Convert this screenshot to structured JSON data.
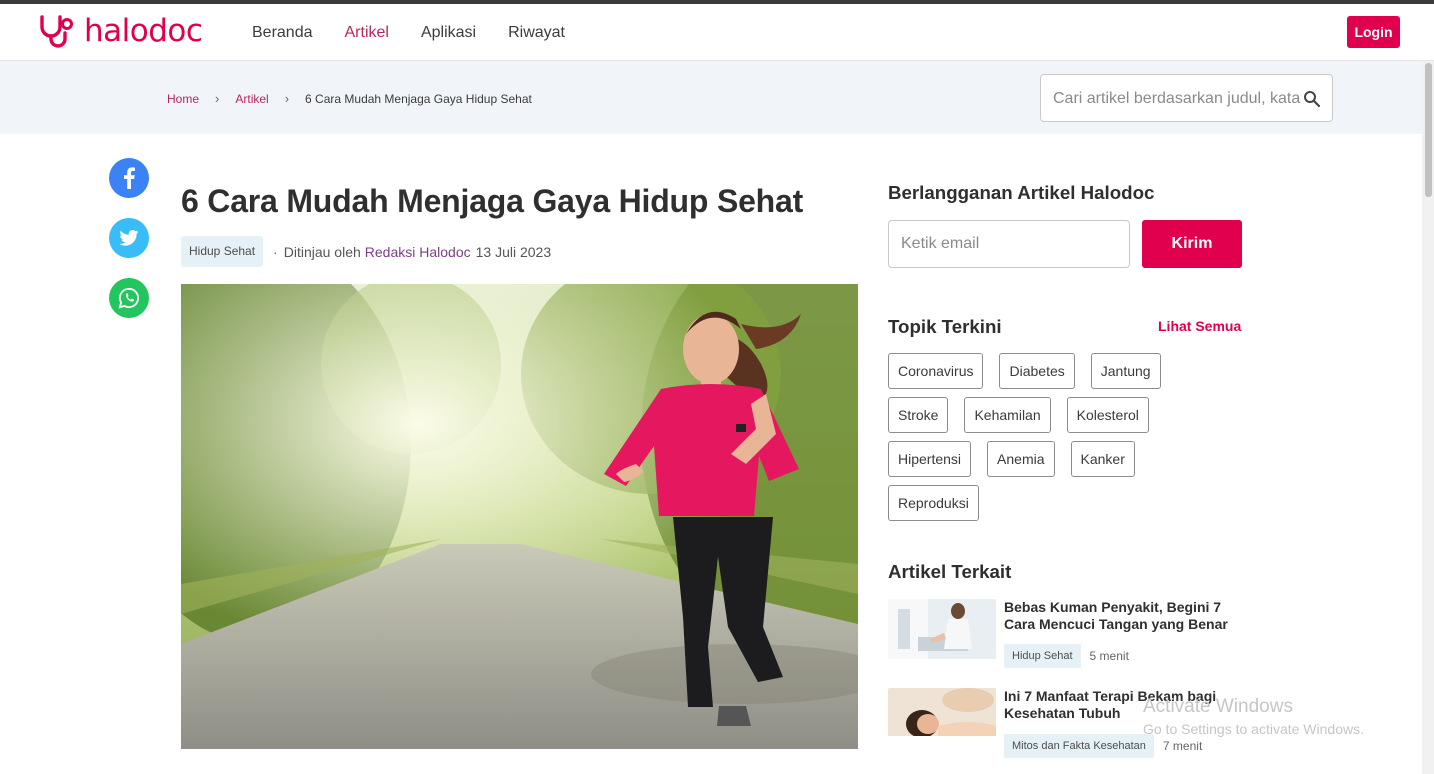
{
  "header": {
    "logo_text": "halodoc",
    "nav": [
      "Beranda",
      "Artikel",
      "Aplikasi",
      "Riwayat"
    ],
    "active_nav": "Artikel",
    "login_label": "Login"
  },
  "breadcrumb": {
    "home": "Home",
    "section": "Artikel",
    "current": "6 Cara Mudah Menjaga Gaya Hidup Sehat"
  },
  "search": {
    "placeholder": "Cari artikel berdasarkan judul, kata kunci"
  },
  "share": [
    "facebook-icon",
    "twitter-icon",
    "whatsapp-icon"
  ],
  "article": {
    "title": "6 Cara Mudah Menjaga Gaya Hidup Sehat",
    "category": "Hidup Sehat",
    "reviewed_prefix": "Ditinjau oleh",
    "reviewer": "Redaksi Halodoc",
    "date": "13 Juli 2023",
    "hero_alt": "woman jogging in park"
  },
  "subscribe": {
    "title": "Berlangganan Artikel Halodoc",
    "email_placeholder": "Ketik email",
    "button": "Kirim"
  },
  "topics": {
    "title": "Topik Terkini",
    "see_all": "Lihat Semua",
    "rows": [
      [
        "Coronavirus",
        "Diabetes",
        "Jantung"
      ],
      [
        "Stroke",
        "Kehamilan",
        "Kolesterol"
      ],
      [
        "Hipertensi",
        "Anemia",
        "Kanker"
      ],
      [
        "Reproduksi"
      ]
    ]
  },
  "related": {
    "title": "Artikel Terkait",
    "items": [
      {
        "title": "Bebas Kuman Penyakit, Begini 7 Cara Mencuci Tangan yang Benar",
        "tag": "Hidup Sehat",
        "time": "5 menit"
      },
      {
        "title": "Ini 7 Manfaat Terapi Bekam bagi Kesehatan Tubuh",
        "tag": "Mitos dan Fakta Kesehatan",
        "time": "7 menit"
      }
    ]
  },
  "watermark": {
    "line1": "Activate Windows",
    "line2": "Go to Settings to activate Windows."
  },
  "colors": {
    "brand": "#e0004d",
    "link": "#b5285b",
    "facebook": "#3b82f6",
    "twitter": "#38bdf8",
    "whatsapp": "#22c55e"
  }
}
